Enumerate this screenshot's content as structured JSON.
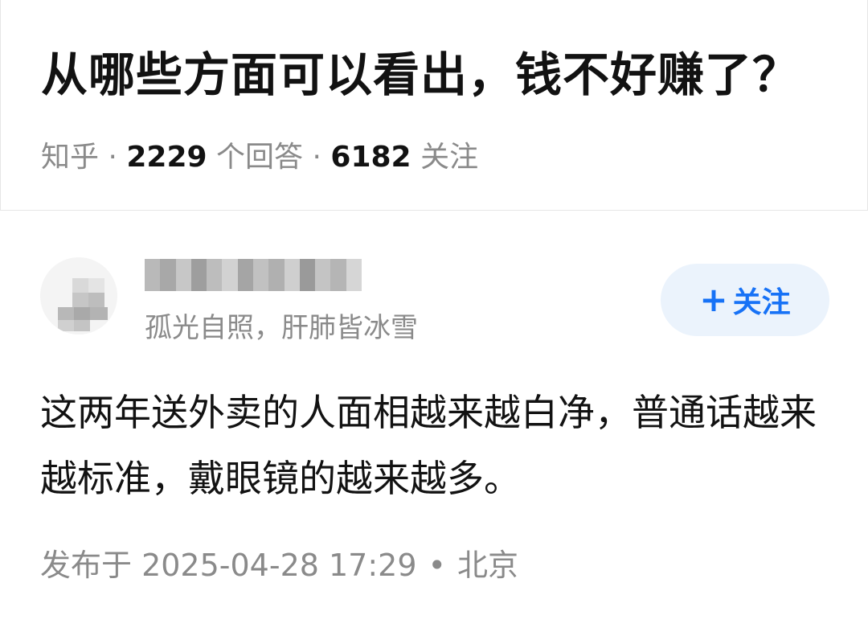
{
  "question": {
    "title": "从哪些方面可以看出，钱不好赚了？",
    "source": "知乎",
    "separator": "·",
    "answer_count": "2229",
    "answer_label": "个回答",
    "follower_count": "6182",
    "follower_label": "关注"
  },
  "answer": {
    "author": {
      "bio": "孤光自照，肝肺皆冰雪"
    },
    "follow_button": {
      "icon": "+",
      "label": "关注",
      "color": "#1772f6",
      "background": "#ebf3fc"
    },
    "content": "这两年送外卖的人面相越来越白净，普通话越来越标准，戴眼镜的越来越多。",
    "footer": {
      "published": "发布于 2025-04-28 17:29",
      "dot": "•",
      "location": "北京"
    }
  }
}
